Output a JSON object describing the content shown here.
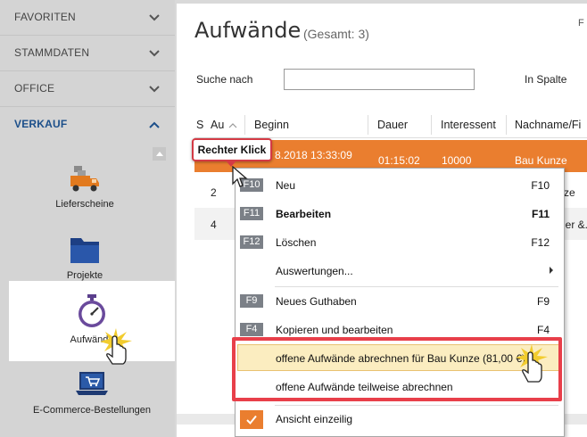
{
  "sidebar": {
    "sections": [
      {
        "label": "FAVORITEN"
      },
      {
        "label": "STAMMDATEN"
      },
      {
        "label": "OFFICE"
      },
      {
        "label": "VERKAUF"
      }
    ],
    "items": [
      {
        "label": "Lieferscheine",
        "icon": "delivery-truck-icon"
      },
      {
        "label": "Projekte",
        "icon": "folder-icon"
      },
      {
        "label": "Aufwände",
        "icon": "stopwatch-icon"
      },
      {
        "label": "E-Commerce-Bestellungen",
        "icon": "laptop-cart-icon"
      }
    ]
  },
  "main": {
    "title": "Aufwände",
    "total": "(Gesamt: 3)",
    "right_edge": "F",
    "search_label": "Suche nach",
    "search_value": "",
    "column_label": "In Spalte",
    "columns": [
      "S",
      "Au",
      "Beginn",
      "Dauer",
      "Interessent",
      "Nachname/Fi"
    ],
    "rows": [
      {
        "nr": "",
        "beginn": "8.2018 13:33:09",
        "dauer": "01:15:02",
        "interessent": "10000",
        "name": "Bau Kunze"
      },
      {
        "nr": "2",
        "beginn": "",
        "dauer": "",
        "interessent": "",
        "name": "ze"
      },
      {
        "nr": "4",
        "beginn": "",
        "dauer": "",
        "interessent": "",
        "name": "ier &."
      }
    ]
  },
  "badge": {
    "label": "Rechter Klick"
  },
  "context_menu": {
    "items": [
      {
        "key": "F10",
        "label": "Neu",
        "shortcut": "F10"
      },
      {
        "key": "F11",
        "label": "Bearbeiten",
        "shortcut": "F11"
      },
      {
        "key": "F12",
        "label": "Löschen",
        "shortcut": "F12"
      },
      {
        "label": "Auswertungen..."
      },
      {
        "key": "F9",
        "label": "Neues Guthaben",
        "shortcut": "F9"
      },
      {
        "key": "F4",
        "label": "Kopieren und bearbeiten",
        "shortcut": "F4"
      },
      {
        "label": "offene Aufwände abrechnen für Bau Kunze (81,00 €)"
      },
      {
        "label": "offene Aufwände teilweise abrechnen"
      },
      {
        "label": "Ansicht einzeilig"
      }
    ]
  },
  "colors": {
    "accent_orange": "#ea7e2f",
    "highlight_red": "#e83f4a",
    "sidebar_active": "#1c4f8a",
    "menu_highlight": "#fbedc0"
  }
}
